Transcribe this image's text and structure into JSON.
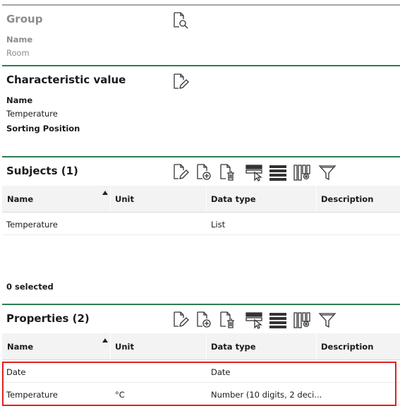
{
  "group": {
    "title": "Group",
    "name_label": "Name",
    "name_value": "Room",
    "search_icon": "document-search-icon"
  },
  "characteristic": {
    "title": "Characteristic value",
    "name_label": "Name",
    "name_value": "Temperature",
    "sorting_label": "Sorting Position",
    "sorting_value": "",
    "edit_icon": "document-edit-icon"
  },
  "subjects": {
    "title": "Subjects (1)",
    "toolbar_icons": [
      "document-edit-icon",
      "document-add-icon",
      "document-delete-icon",
      "select-rows-icon",
      "rows-list-icon",
      "column-settings-icon",
      "filter-icon"
    ],
    "columns": [
      "Name",
      "Unit",
      "Data type",
      "Description"
    ],
    "sorted_column": "Name",
    "rows": [
      {
        "name": "Temperature",
        "unit": "",
        "data_type": "List",
        "description": ""
      }
    ],
    "selected_text": "0 selected"
  },
  "properties": {
    "title": "Properties (2)",
    "toolbar_icons": [
      "document-edit-icon",
      "document-add-icon",
      "document-delete-icon",
      "select-rows-icon",
      "rows-list-icon",
      "column-settings-icon",
      "filter-icon"
    ],
    "columns": [
      "Name",
      "Unit",
      "Data type",
      "Description"
    ],
    "sorted_column": "Name",
    "rows": [
      {
        "name": "Date",
        "unit": "",
        "data_type": "Date",
        "description": ""
      },
      {
        "name": "Temperature",
        "unit": "°C",
        "data_type": "Number (10 digits, 2 deci...",
        "description": ""
      }
    ]
  },
  "colors": {
    "section_rule": "#2e7d4f",
    "group_rule": "#a6a6a6",
    "highlight": "#e02020",
    "header_bg": "#f3f3f3"
  }
}
